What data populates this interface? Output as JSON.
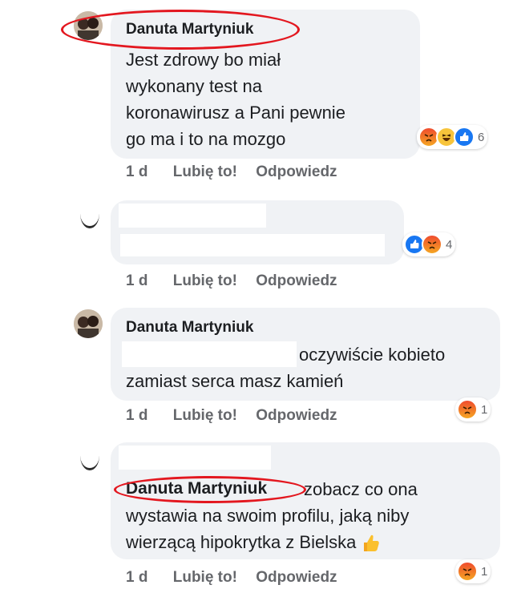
{
  "comments": [
    {
      "author": "Danuta Martyniuk",
      "lines": [
        "Jest zdrowy bo miał",
        "wykonany test na",
        "koronawirusz a Pani pewnie",
        "go ma i to na mozgo"
      ],
      "reaction_count": "6",
      "time": "1 d",
      "like": "Lubię to!",
      "reply": "Odpowiedz"
    },
    {
      "author": "",
      "reaction_count": "4",
      "time": "1 d",
      "like": "Lubię to!",
      "reply": "Odpowiedz"
    },
    {
      "author": "Danuta Martyniuk",
      "lines": [
        "oczywiście kobieto",
        "zamiast serca masz kamień"
      ],
      "reaction_count": "1",
      "time": "1 d",
      "like": "Lubię to!",
      "reply": "Odpowiedz"
    },
    {
      "author": "Danuta Martyniuk",
      "lines": [
        "zobacz co ona",
        "wystawia na swoim profilu, jaką niby",
        "wierzącą hipokrytka z Bielska"
      ],
      "reaction_count": "1",
      "time": "1 d",
      "like": "Lubię to!",
      "reply": "Odpowiedz"
    }
  ],
  "colors": {
    "highlight": "#e3171f",
    "bubble": "#f0f2f5",
    "like_blue": "#1877f2"
  },
  "icons": [
    "angry-reaction-icon",
    "haha-reaction-icon",
    "like-reaction-icon",
    "thumbs-up-emoji-icon"
  ]
}
